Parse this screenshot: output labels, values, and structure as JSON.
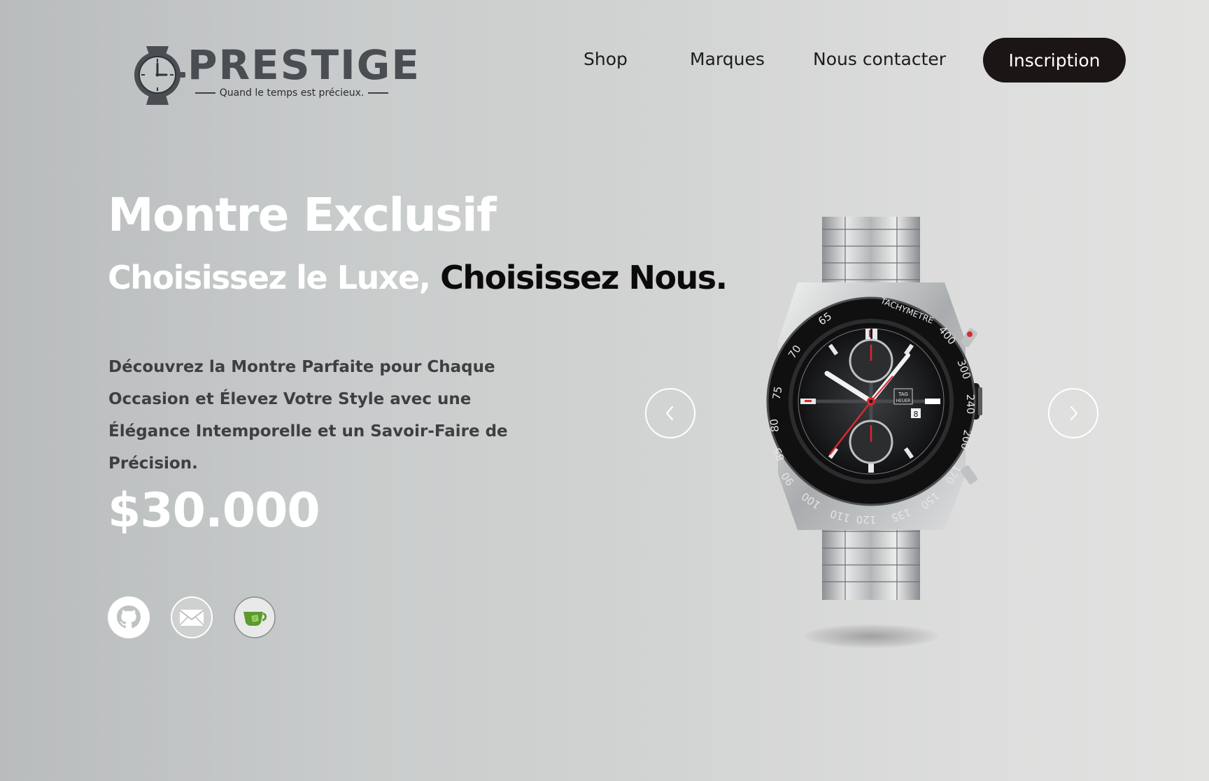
{
  "logo": {
    "wordmark": "PRESTIGE",
    "tagline": "Quand le temps est précieux."
  },
  "nav": {
    "items": [
      {
        "label": "Shop"
      },
      {
        "label": "Marques"
      },
      {
        "label": "Nous contacter"
      }
    ],
    "cta_label": "Inscription"
  },
  "hero": {
    "title": "Montre Exclusif",
    "subtitle_light": "Choisissez le Luxe,",
    "subtitle_dark": "Choisissez Nous.",
    "description": "Découvrez la Montre Parfaite pour Chaque Occasion et Élevez Votre Style avec une Élégance Intemporelle et un Savoir-Faire de Précision.",
    "price": "$30.000"
  },
  "social": {
    "icons": [
      "github-icon",
      "mail-icon",
      "tea-cup-icon"
    ]
  },
  "carousel": {
    "prev_icon": "chevron-left-icon",
    "next_icon": "chevron-right-icon"
  },
  "watch": {
    "bezel_label": "TACHYMETRE",
    "bezel_numbers": [
      "65",
      "70",
      "75",
      "80",
      "85",
      "90",
      "100",
      "110",
      "120",
      "135",
      "150",
      "170",
      "200",
      "240",
      "300",
      "400"
    ],
    "brand_top": "TAG",
    "brand_bottom": "HEUER",
    "date": "8"
  },
  "colors": {
    "cta_background": "#1b1516",
    "text_dark": "#0b0b0b",
    "body_text": "#3f3f42",
    "accent_red": "#d8282e"
  }
}
